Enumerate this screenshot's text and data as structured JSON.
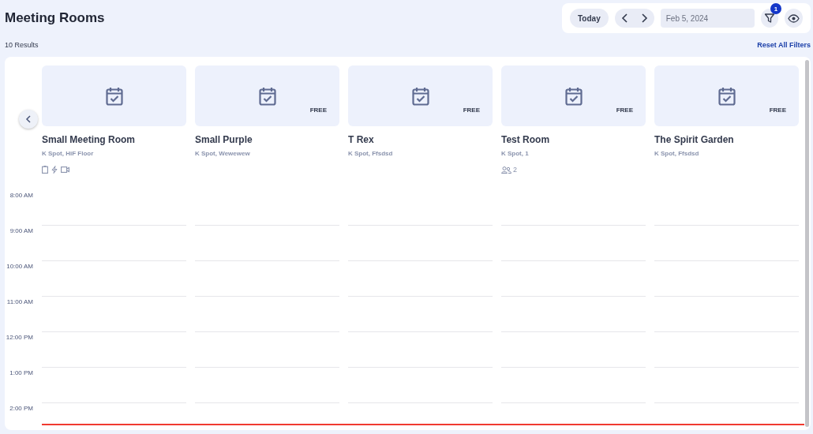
{
  "title": "Meeting Rooms",
  "toolbar": {
    "today": "Today",
    "date": "Feb 5, 2024",
    "filter_count": "1"
  },
  "results": "10 Results",
  "reset": "Reset All Filters",
  "rooms": [
    {
      "name": "Small Meeting Room",
      "location": "K Spot, HiF Floor",
      "amenities": [
        {
          "kind": "whiteboard"
        },
        {
          "kind": "power"
        },
        {
          "kind": "video"
        }
      ]
    },
    {
      "name": "Small Purple",
      "location": "K Spot, Wewewew",
      "badge": "FREE"
    },
    {
      "name": "T Rex",
      "location": "K Spot, Ffsdsd",
      "badge": "FREE"
    },
    {
      "name": "Test Room",
      "location": "K Spot, 1",
      "badge": "FREE",
      "capacity": "2"
    },
    {
      "name": "The Spirit Garden",
      "location": "K Spot, Ffsdsd",
      "badge": "FREE"
    }
  ],
  "times": [
    "8:00 AM",
    "9:00 AM",
    "10:00 AM",
    "11:00 AM",
    "12:00 PM",
    "1:00 PM",
    "2:00 PM"
  ]
}
